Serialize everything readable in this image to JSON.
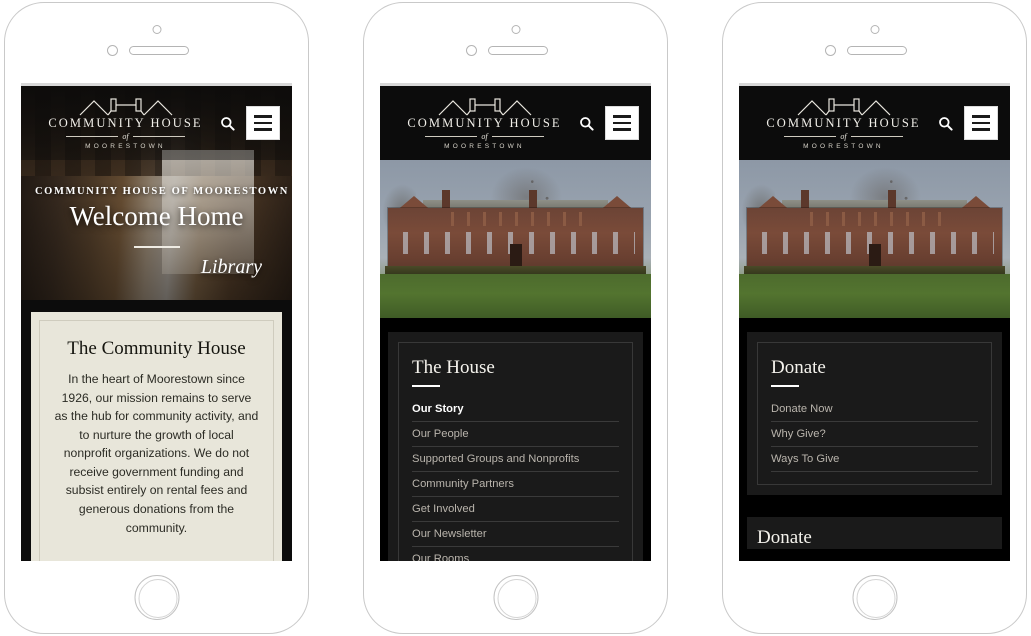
{
  "brand": {
    "name": "COMMUNITY HOUSE",
    "connector": "of",
    "town": "MOORESTOWN",
    "logo_mark_icon": "house-roofline-icon"
  },
  "header": {
    "search_icon": "search-icon",
    "menu_icon": "hamburger-menu-icon",
    "search_label": "Search",
    "menu_label": "Menu"
  },
  "colors": {
    "header_bg": "#0c0c0c",
    "page_bg": "#000000",
    "panel_bg": "#1a1a1a",
    "panel_border": "#383838",
    "card_bg": "#e8e6da",
    "accent_rule": "#ffffff",
    "link": "#b9b4ac",
    "link_active": "#ffffff",
    "frame": "#ffffff",
    "frame_border": "#c9c9c9"
  },
  "phones": [
    {
      "id": "phone-home",
      "hero": {
        "background_image": "library-interior-photo",
        "eyebrow": "COMMUNITY HOUSE OF MOORESTOWN",
        "title": "Welcome Home",
        "subtitle": "Library"
      },
      "article": {
        "title": "The Community House",
        "body": "In the heart of Moorestown since 1926, our mission remains to serve as the hub for community activity, and to nurture the growth of local nonprofit organizations. We do not receive government funding and subsist entirely on rental fees and generous donations from the community."
      }
    },
    {
      "id": "phone-the-house",
      "hero": {
        "background_image": "community-house-mansion-photo"
      },
      "panel": {
        "title": "The House",
        "items": [
          {
            "label": "Our Story",
            "active": true
          },
          {
            "label": "Our People",
            "active": false
          },
          {
            "label": "Supported Groups and Nonprofits",
            "active": false
          },
          {
            "label": "Community Partners",
            "active": false
          },
          {
            "label": "Get Involved",
            "active": false
          },
          {
            "label": "Our Newsletter",
            "active": false
          },
          {
            "label": "Our Rooms",
            "active": false
          }
        ]
      }
    },
    {
      "id": "phone-donate",
      "hero": {
        "background_image": "community-house-mansion-photo"
      },
      "panel": {
        "title": "Donate",
        "items": [
          {
            "label": "Donate Now",
            "active": false
          },
          {
            "label": "Why Give?",
            "active": false
          },
          {
            "label": "Ways To Give",
            "active": false
          }
        ]
      },
      "panel_next": {
        "title": "Donate"
      }
    }
  ]
}
